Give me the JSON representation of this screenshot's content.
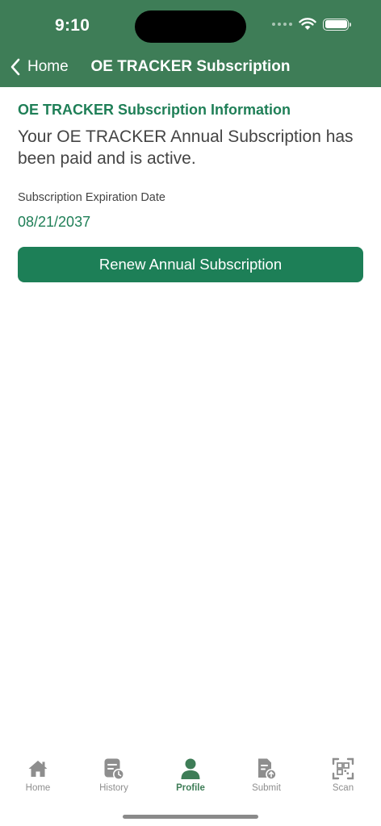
{
  "status_bar": {
    "time": "9:10"
  },
  "nav": {
    "back_label": "Home",
    "title": "OE TRACKER Subscription"
  },
  "subscription": {
    "section_title": "OE TRACKER Subscription Information",
    "message": "Your OE TRACKER Annual Subscription has been paid and is active.",
    "expiry_label": "Subscription Expiration Date",
    "expiry_date": "08/21/2037",
    "renew_button": "Renew Annual Subscription"
  },
  "tabs": [
    {
      "label": "Home",
      "icon": "house-icon"
    },
    {
      "label": "History",
      "icon": "history-icon"
    },
    {
      "label": "Profile",
      "icon": "person-icon",
      "active": true
    },
    {
      "label": "Submit",
      "icon": "submit-document-icon"
    },
    {
      "label": "Scan",
      "icon": "qr-scan-icon"
    }
  ],
  "colors": {
    "header": "#3e7d57",
    "accent": "#1f7f57",
    "button": "#1d7f57",
    "inactive_tab": "#8e8e8e"
  }
}
